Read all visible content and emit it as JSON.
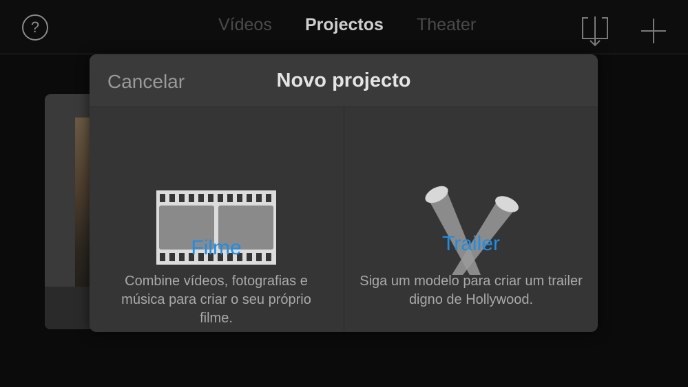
{
  "topbar": {
    "help_label": "?",
    "tabs": [
      {
        "label": "Vídeos",
        "active": false
      },
      {
        "label": "Projectos",
        "active": true
      },
      {
        "label": "Theater",
        "active": false
      }
    ]
  },
  "modal": {
    "cancel_label": "Cancelar",
    "title": "Novo projecto",
    "options": [
      {
        "label": "Filme",
        "description": "Combine vídeos, fotografias e música para criar o seu próprio filme.",
        "icon": "film-strip-icon"
      },
      {
        "label": "Trailer",
        "description": "Siga um modelo para criar um trailer digno de Hollywood.",
        "icon": "spotlights-icon"
      }
    ]
  },
  "colors": {
    "accent": "#1e8ee6",
    "background": "#0b0b0b",
    "modal": "#353535"
  }
}
